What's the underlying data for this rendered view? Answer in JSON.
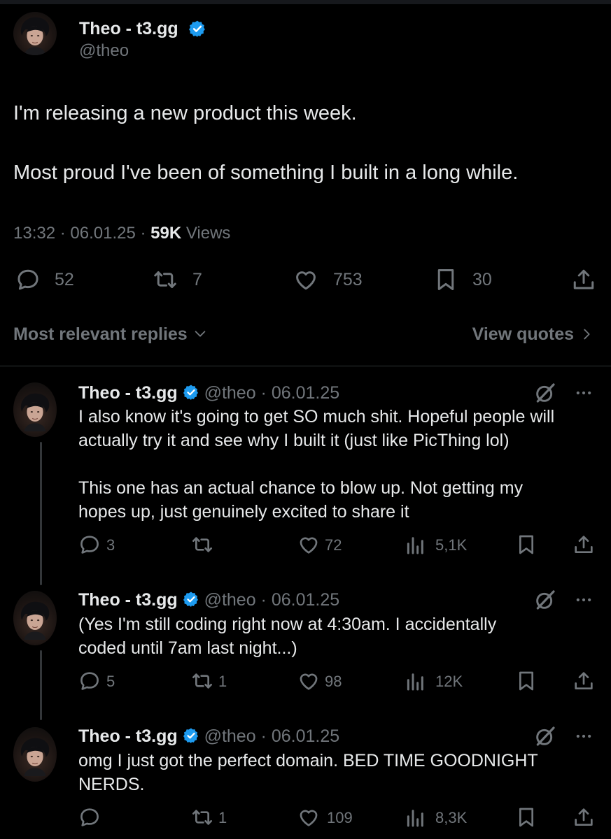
{
  "main_post": {
    "author_name": "Theo - t3.gg",
    "handle": "@theo",
    "text_line1": "I'm releasing a new product this week.",
    "text_line2": "Most proud I've been of something I built in a long while.",
    "time": "13:32",
    "date": "06.01.25",
    "views_count": "59K",
    "views_label": "Views",
    "replies": "52",
    "reposts": "7",
    "likes": "753",
    "bookmarks": "30"
  },
  "filter": {
    "sort_label": "Most relevant replies",
    "quotes_label": "View quotes"
  },
  "replies": [
    {
      "author_name": "Theo - t3.gg",
      "handle": "@theo",
      "date": "06.01.25",
      "lines": [
        "I also know it's going to get SO much shit. Hopeful people will",
        "actually try it and see why I built it (just like PicThing lol)",
        "",
        "This one has an actual chance to blow up. Not getting my",
        "hopes up, just genuinely excited to share it"
      ],
      "replies": "3",
      "reposts": "",
      "likes": "72",
      "views": "5,1K"
    },
    {
      "author_name": "Theo - t3.gg",
      "handle": "@theo",
      "date": "06.01.25",
      "lines": [
        "(Yes I'm still coding right now at 4:30am. I accidentally",
        "coded until 7am last night...)"
      ],
      "replies": "5",
      "reposts": "1",
      "likes": "98",
      "views": "12K"
    },
    {
      "author_name": "Theo - t3.gg",
      "handle": "@theo",
      "date": "06.01.25",
      "lines": [
        "omg I just got the perfect domain. BED TIME GOODNIGHT",
        "NERDS."
      ],
      "replies": "",
      "reposts": "1",
      "likes": "109",
      "views": "8,3K"
    }
  ],
  "colors": {
    "background": "#000000",
    "text": "#e7e9ea",
    "muted": "#71767b",
    "verified": "#1d9bf0",
    "divider": "#2f3336"
  }
}
